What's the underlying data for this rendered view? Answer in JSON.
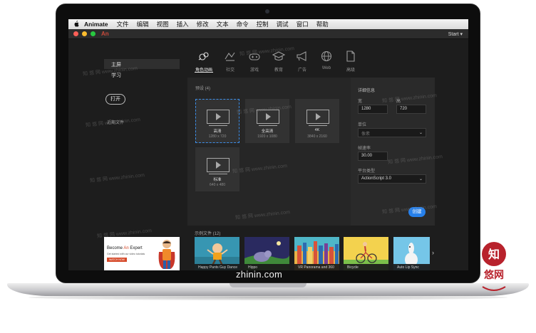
{
  "menubar": {
    "app_name": "Animate",
    "items": [
      "文件",
      "编辑",
      "视图",
      "插入",
      "修改",
      "文本",
      "命令",
      "控制",
      "调试",
      "窗口",
      "帮助"
    ],
    "workspace": "Start ▾"
  },
  "titlebar": {
    "app_logo": "An"
  },
  "sidebar": {
    "home": "主屏",
    "learn": "学习",
    "open_button": "打开",
    "recent_label": "近期文件"
  },
  "categories": [
    {
      "label": "角色动画",
      "icon": "character-animation-icon",
      "active": true
    },
    {
      "label": "社交",
      "icon": "social-icon",
      "active": false
    },
    {
      "label": "游戏",
      "icon": "game-icon",
      "active": false
    },
    {
      "label": "教育",
      "icon": "education-icon",
      "active": false
    },
    {
      "label": "广告",
      "icon": "advertising-icon",
      "active": false
    },
    {
      "label": "Web",
      "icon": "globe-icon",
      "active": false
    },
    {
      "label": "高级",
      "icon": "document-icon",
      "active": false
    }
  ],
  "presets": {
    "title": "预设 (4)",
    "items": [
      {
        "name": "高清",
        "dim": "1280 x 720",
        "selected": true
      },
      {
        "name": "全高清",
        "dim": "1920 x 1080",
        "selected": false
      },
      {
        "name": "4K",
        "dim": "3840 x 2160",
        "selected": false
      },
      {
        "name": "标准",
        "dim": "640 x 480",
        "selected": false
      }
    ]
  },
  "details": {
    "title": "详细信息",
    "width_label": "宽",
    "width_value": "1280",
    "height_label": "高",
    "height_value": "720",
    "unit_label": "单位",
    "unit_value": "像素",
    "fps_label": "帧速率",
    "fps_value": "30.00",
    "platform_label": "平台类型",
    "platform_value": "ActionScript 3.0",
    "create_button": "创建"
  },
  "samples": {
    "title": "示例文件 (12)",
    "promo": {
      "line1_a": "Become ",
      "line1_b": "An",
      "line1_c": " Expert",
      "line2": "Get started with our video tutorials",
      "button": "WATCH NOW"
    },
    "items": [
      "Happy Pants Guy Dance",
      "Hippo",
      "VR Panorama and 360",
      "Bicycle",
      "Auto Lip Sync"
    ]
  },
  "watermarks": {
    "text": "知 悠 网 www.zhinin.com",
    "logo_top": "知",
    "logo_bottom": "悠网"
  },
  "site_caption": "zhinin.com",
  "colors": {
    "accent": "#2680eb",
    "selected_border": "#3d8ee8",
    "an_brand": "#c84a3a",
    "watermark_red": "#b8222c"
  }
}
